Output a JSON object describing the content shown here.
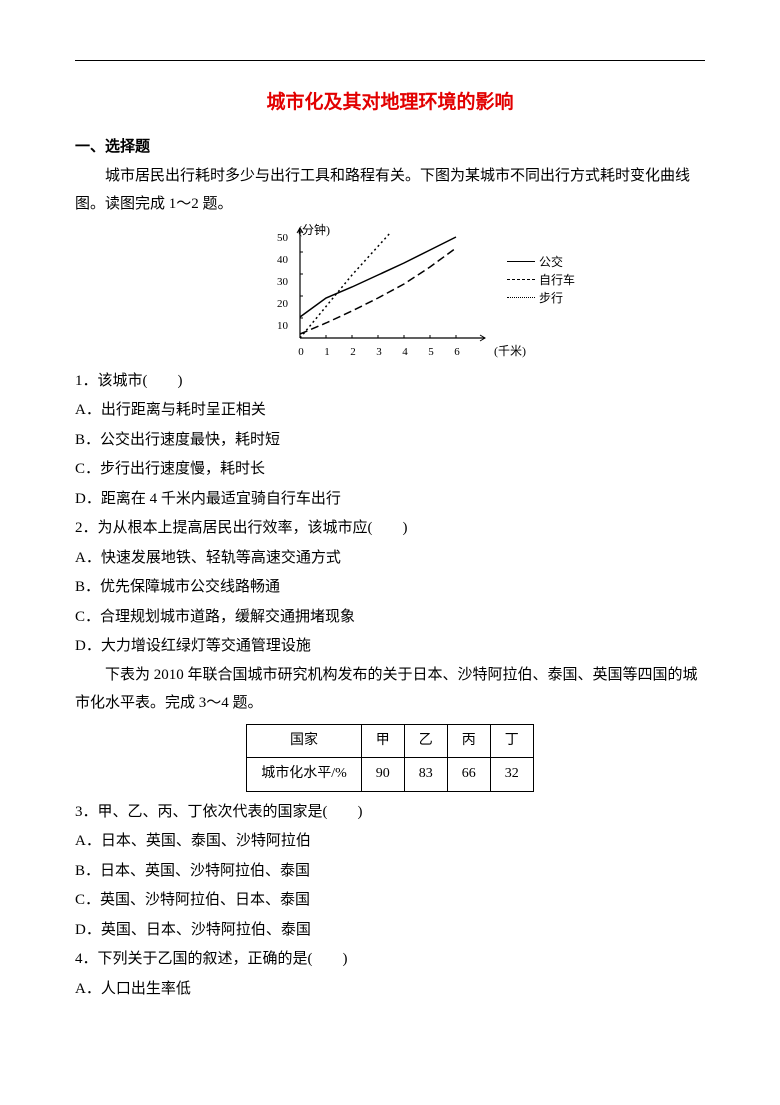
{
  "title": "城市化及其对地理环境的影响",
  "section_one": "一、选择题",
  "intro1": "城市居民出行耗时多少与出行工具和路程有关。下图为某城市不同出行方式耗时变化曲线图。读图完成 1～2 题。",
  "q1": {
    "stem": "1．该城市(　　)",
    "A": "A．出行距离与耗时呈正相关",
    "B": "B．公交出行速度最快，耗时短",
    "C": "C．步行出行速度慢，耗时长",
    "D": "D．距离在 4 千米内最适宜骑自行车出行"
  },
  "q2": {
    "stem": "2．为从根本上提高居民出行效率，该城市应(　　)",
    "A": "A．快速发展地铁、轻轨等高速交通方式",
    "B": "B．优先保障城市公交线路畅通",
    "C": "C．合理规划城市道路，缓解交通拥堵现象",
    "D": "D．大力增设红绿灯等交通管理设施"
  },
  "intro2": "下表为 2010 年联合国城市研究机构发布的关于日本、沙特阿拉伯、泰国、英国等四国的城市化水平表。完成 3～4 题。",
  "table": {
    "h1": "国家",
    "c1": "甲",
    "c2": "乙",
    "c3": "丙",
    "c4": "丁",
    "r1": "城市化水平/%",
    "v1": "90",
    "v2": "83",
    "v3": "66",
    "v4": "32"
  },
  "q3": {
    "stem": "3．甲、乙、丙、丁依次代表的国家是(　　)",
    "A": "A．日本、英国、泰国、沙特阿拉伯",
    "B": "B．日本、英国、沙特阿拉伯、泰国",
    "C": "C．英国、沙特阿拉伯、日本、泰国",
    "D": "D．英国、日本、沙特阿拉伯、泰国"
  },
  "q4": {
    "stem": "4．下列关于乙国的叙述，正确的是(　　)",
    "A": "A．人口出生率低"
  },
  "chart_data": {
    "type": "line",
    "xlabel": "(千米)",
    "ylabel": "(分钟)",
    "x_ticks": [
      0,
      1,
      2,
      3,
      4,
      5,
      6
    ],
    "y_ticks": [
      0,
      10,
      20,
      30,
      40,
      50
    ],
    "series": [
      {
        "name": "公交",
        "style": "solid",
        "x": [
          0,
          1,
          2,
          3,
          4,
          5,
          6
        ],
        "y": [
          10,
          19,
          24,
          30,
          36,
          42,
          48
        ]
      },
      {
        "name": "自行车",
        "style": "longdash",
        "x": [
          0,
          1,
          2,
          3,
          4,
          5,
          6
        ],
        "y": [
          2,
          7,
          13,
          19,
          26,
          34,
          43
        ]
      },
      {
        "name": "步行",
        "style": "dot",
        "x": [
          0,
          2,
          3.5
        ],
        "y": [
          0,
          30,
          50
        ]
      }
    ]
  }
}
